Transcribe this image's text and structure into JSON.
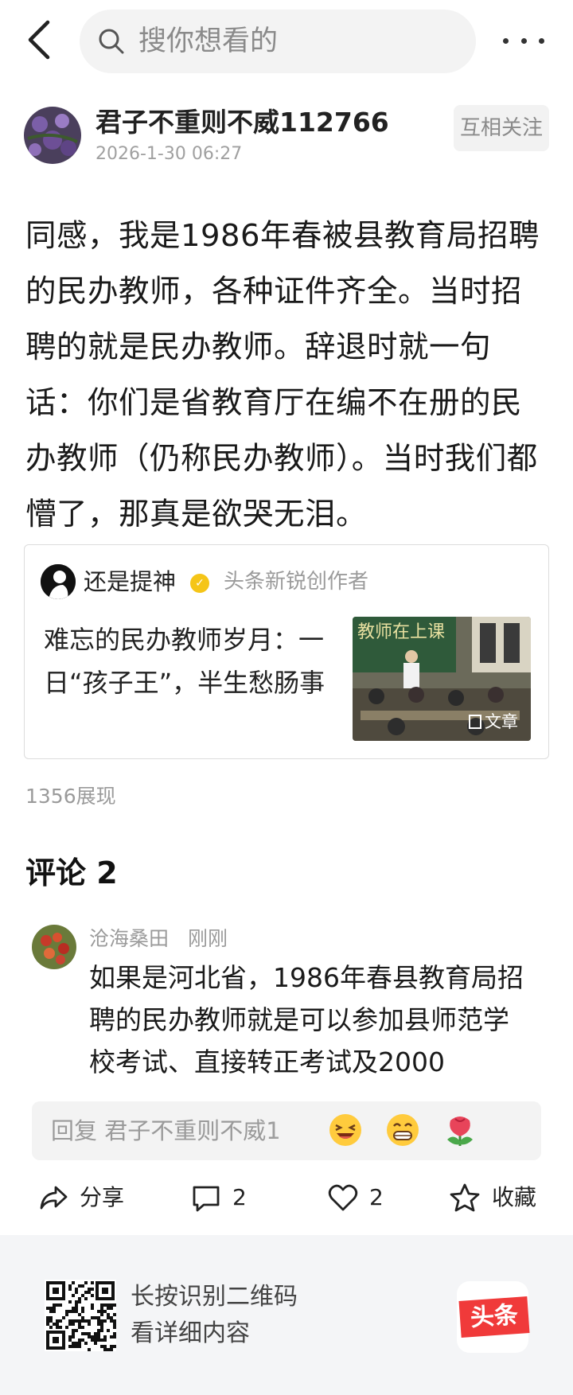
{
  "topbar": {
    "search_placeholder": "搜你想看的",
    "back_icon": "chevron-left-icon",
    "more_icon": "more-horizontal-icon"
  },
  "post": {
    "author_name": "君子不重则不威112766",
    "time": "2026-1-30 06:27",
    "follow_label": "互相关注",
    "content": "同感，我是1986年春被县教育局招聘的民办教师，各种证件齐全。当时招聘的就是民办教师。辞退时就一句话：你们是省教育厅在编不在册的民办教师（仍称民办教师）。当时我们都懵了，那真是欲哭无泪。",
    "quoted_article": {
      "author": "还是提神",
      "author_tag": "头条新锐创作者",
      "title": "难忘的民办教师岁月：一日“孩子王”，半生愁肠事",
      "thumb_tag": "文章",
      "thumb_board_text": "教师在上课"
    },
    "views": "1356展现"
  },
  "comments": {
    "header": "评论 2",
    "items": [
      {
        "user": "沧海桑田",
        "time": "刚刚",
        "text": "如果是河北省，1986年春县教育局招聘的民办教师就是可以参加县师范学校考试、直接转正考试及2000"
      }
    ]
  },
  "reply_bar": {
    "placeholder": "回复 君子不重则不威1",
    "emojis": [
      "laughing-emoji",
      "grinning-emoji",
      "flower-emoji"
    ]
  },
  "actions": {
    "share_label": "分享",
    "comment_count": "2",
    "like_count": "2",
    "favorite_label": "收藏"
  },
  "footer": {
    "line1": "长按识别二维码",
    "line2": "看详细内容",
    "logo_text": "头条"
  },
  "colors": {
    "brand_red": "#f03a3a",
    "muted_text": "#9a9a9a",
    "badge_yellow": "#f5c518"
  }
}
